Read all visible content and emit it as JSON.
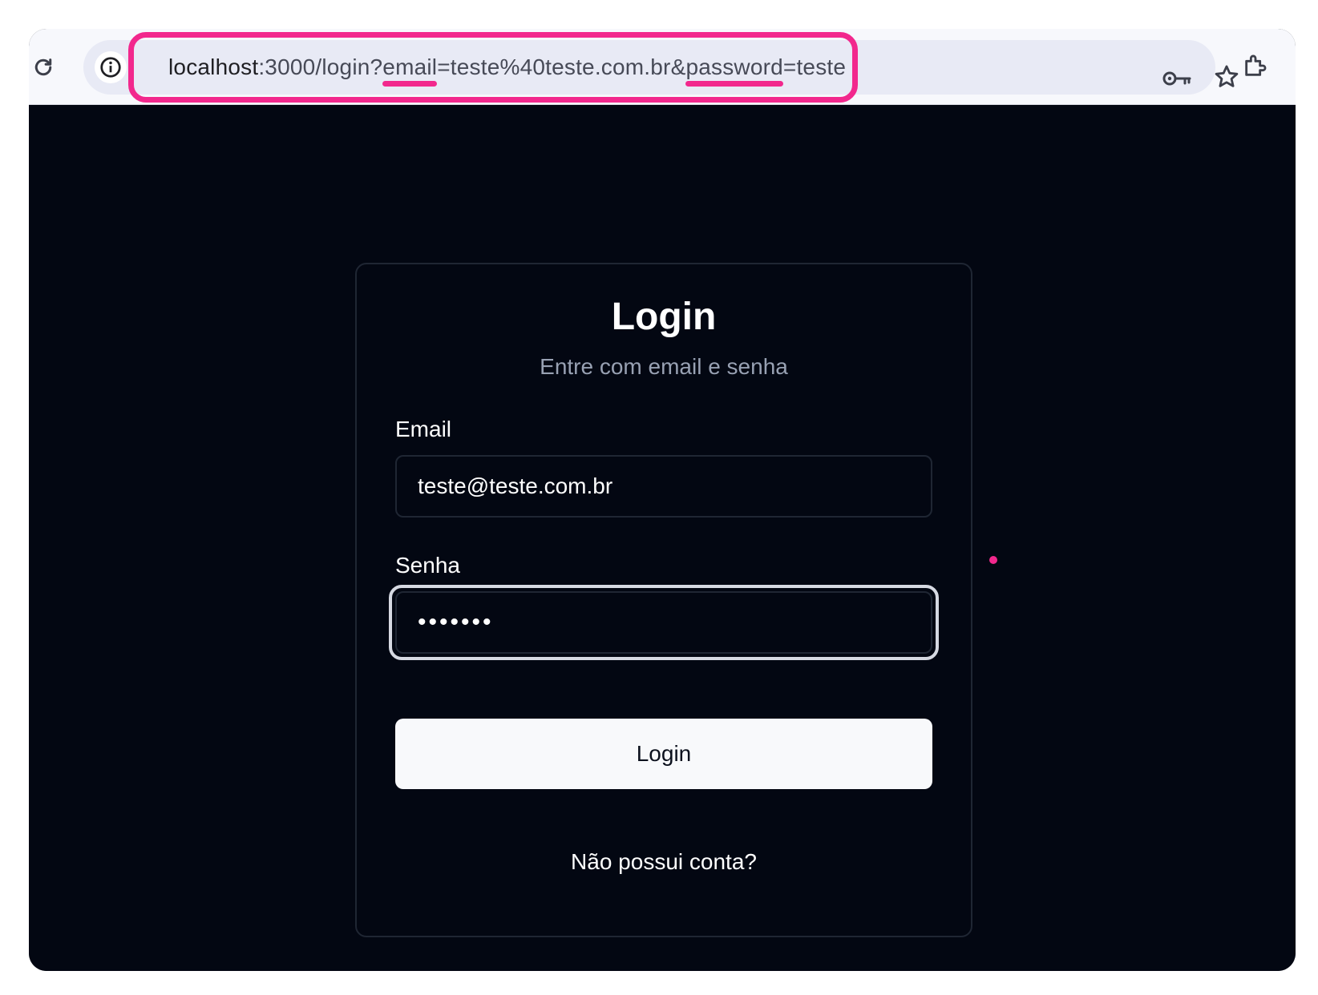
{
  "browser": {
    "url_host": "localhost",
    "url_path_prefix": ":3000/login?",
    "url_param1_key": "email",
    "url_param1_rest": "=teste%40teste.com.br&",
    "url_param2_key": "password",
    "url_param2_rest": "=teste",
    "icons": [
      "reload-icon",
      "site-info-icon",
      "key-icon",
      "star-icon",
      "extensions-icon"
    ],
    "highlight_color": "#f2288d"
  },
  "login": {
    "title": "Login",
    "subtitle": "Entre com email e senha",
    "email_label": "Email",
    "email_value": "teste@teste.com.br",
    "password_label": "Senha",
    "password_masked": "•••••••",
    "submit_label": "Login",
    "signup_link": "Não possui conta?"
  },
  "colors": {
    "page_background": "#030712",
    "button_background": "#f8f9fb",
    "subtitle_text": "#98a1b3"
  }
}
